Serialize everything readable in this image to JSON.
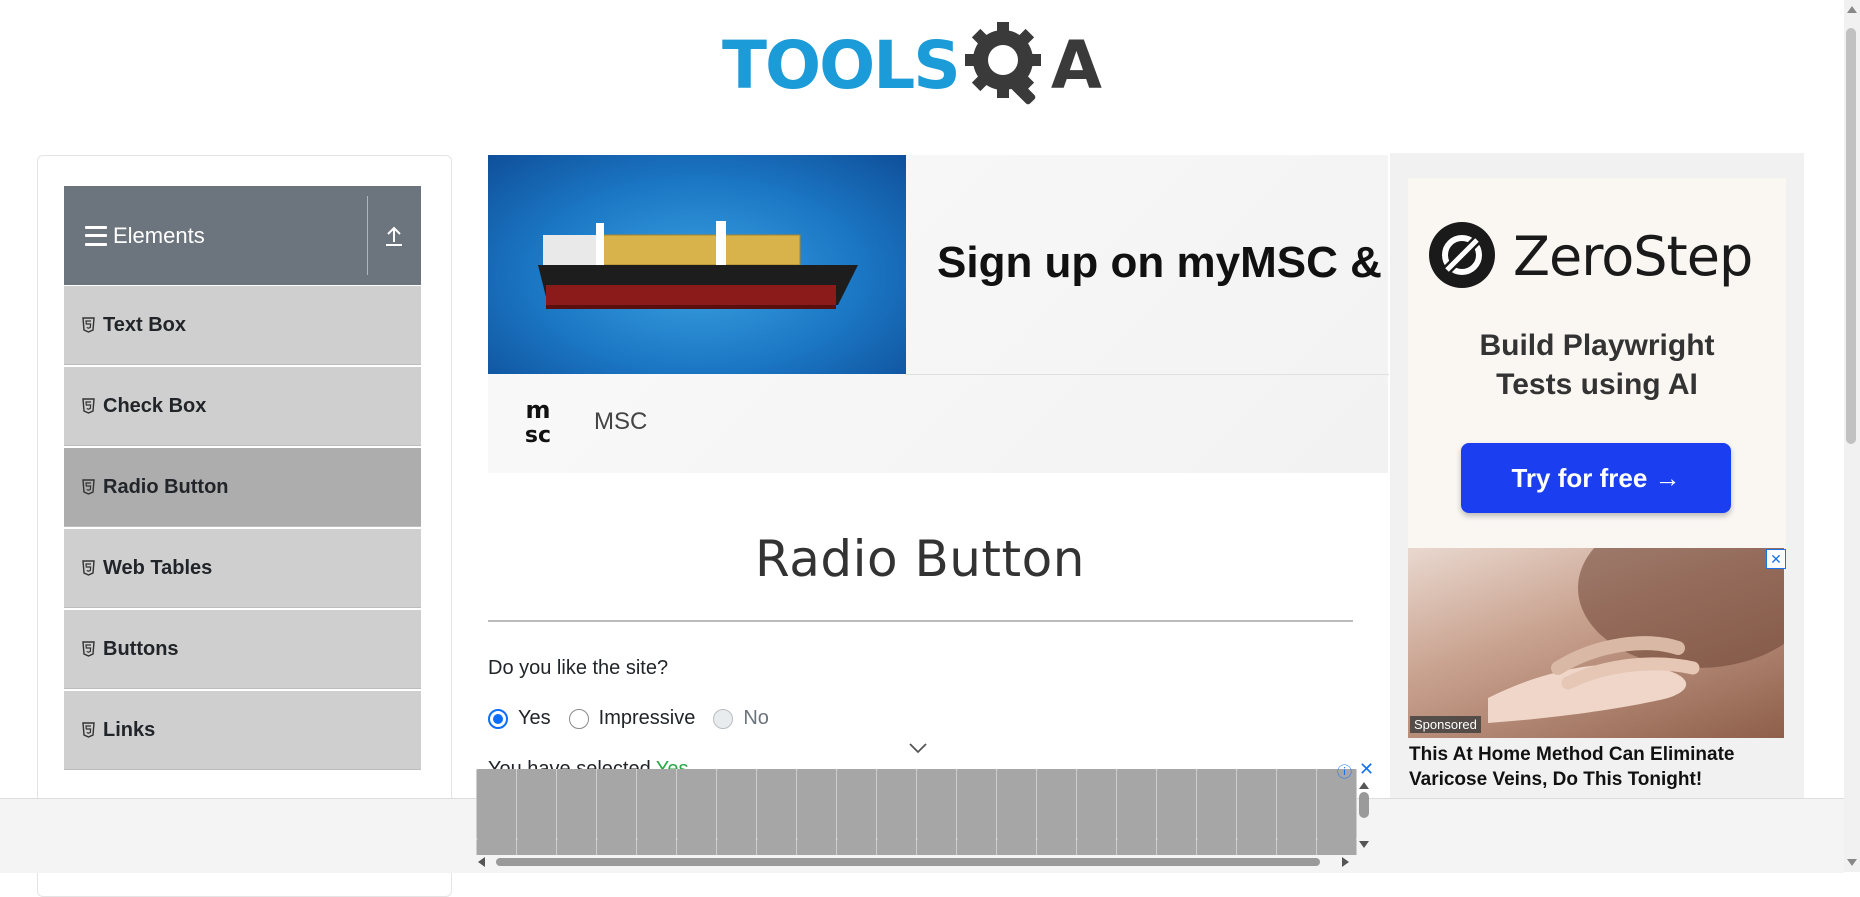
{
  "header": {
    "logo_text": "TOOLS",
    "logo_q": "Q",
    "logo_a": "A"
  },
  "sidebar": {
    "group_title": "Elements",
    "items": [
      {
        "label": "Text Box",
        "active": false
      },
      {
        "label": "Check Box",
        "active": false
      },
      {
        "label": "Radio Button",
        "active": true
      },
      {
        "label": "Web Tables",
        "active": false
      },
      {
        "label": "Buttons",
        "active": false
      },
      {
        "label": "Links",
        "active": false
      }
    ]
  },
  "top_ad": {
    "headline": "Sign up on myMSC & B",
    "brand": "MSC",
    "brand_logo_text": "msc"
  },
  "main": {
    "title": "Radio Button",
    "question": "Do you like the site?",
    "options": [
      {
        "label": "Yes",
        "state": "checked"
      },
      {
        "label": "Impressive",
        "state": "unchecked"
      },
      {
        "label": "No",
        "state": "disabled"
      }
    ],
    "result_prefix": "You have selected ",
    "result_value": "Yes"
  },
  "right_ad": {
    "brand": "ZeroStep",
    "tagline_line1": "Build Playwright",
    "tagline_line2": "Tests using AI",
    "cta": "Try for free →",
    "sponsored": "Sponsored",
    "headline": "This At Home Method Can Eliminate Varicose Veins, Do This Tonight!",
    "close": "✕"
  },
  "bottom_ad": {
    "adchoices": "ⓘ",
    "close": "✕"
  },
  "colors": {
    "accent": "#0d6efd",
    "selected_value": "#28a745",
    "sidebar_header": "#6c757d",
    "logo_blue": "#1b9bd7",
    "cta_blue": "#1b3ef0"
  }
}
